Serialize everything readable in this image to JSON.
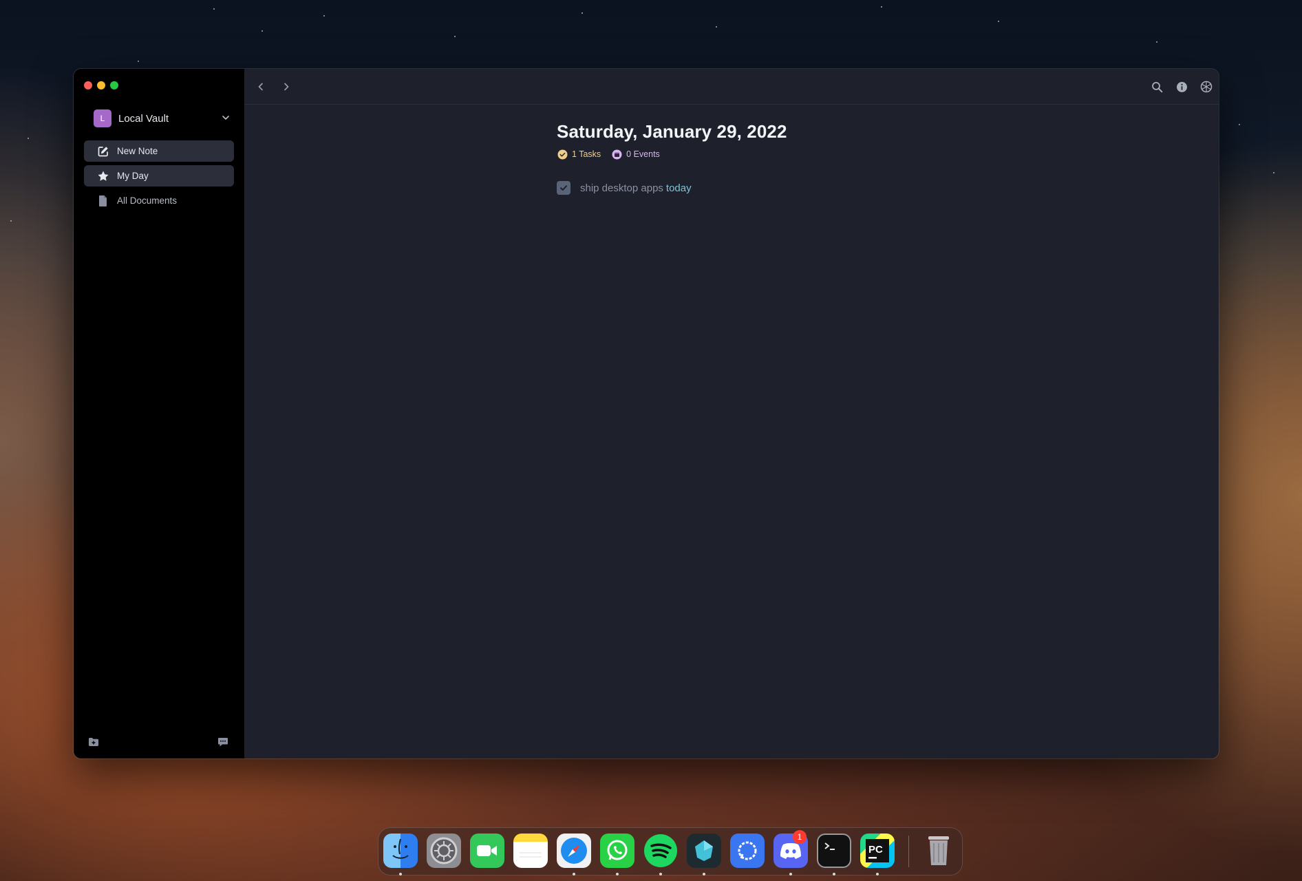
{
  "window": {
    "traffic_lights": [
      "close",
      "minimize",
      "zoom"
    ]
  },
  "sidebar": {
    "vault": {
      "initial": "L",
      "name": "Local Vault",
      "badge_color": "#a769c9"
    },
    "items": [
      {
        "label": "New Note",
        "icon": "edit-icon"
      },
      {
        "label": "My Day",
        "icon": "star-icon"
      },
      {
        "label": "All Documents",
        "icon": "document-icon"
      }
    ],
    "bottom": {
      "left_icon": "folder-add-icon",
      "right_icon": "chat-icon"
    }
  },
  "toolbar": {
    "nav": [
      "back-icon",
      "forward-icon"
    ],
    "right": [
      "search-icon",
      "info-icon",
      "settings-icon"
    ]
  },
  "document": {
    "title": "Saturday, January 29, 2022",
    "tasks_label": "1 Tasks",
    "events_label": "0 Events",
    "tasks": [
      {
        "text": "ship desktop apps",
        "tag": "today",
        "checked": true
      }
    ]
  },
  "dock": {
    "apps": [
      "Finder",
      "System Preferences",
      "FaceTime",
      "Notes",
      "Safari",
      "WhatsApp",
      "Spotify",
      "Crystal",
      "Signal",
      "Discord",
      "Terminal",
      "PyCharm",
      "Trash"
    ],
    "discord_badge": "1"
  }
}
